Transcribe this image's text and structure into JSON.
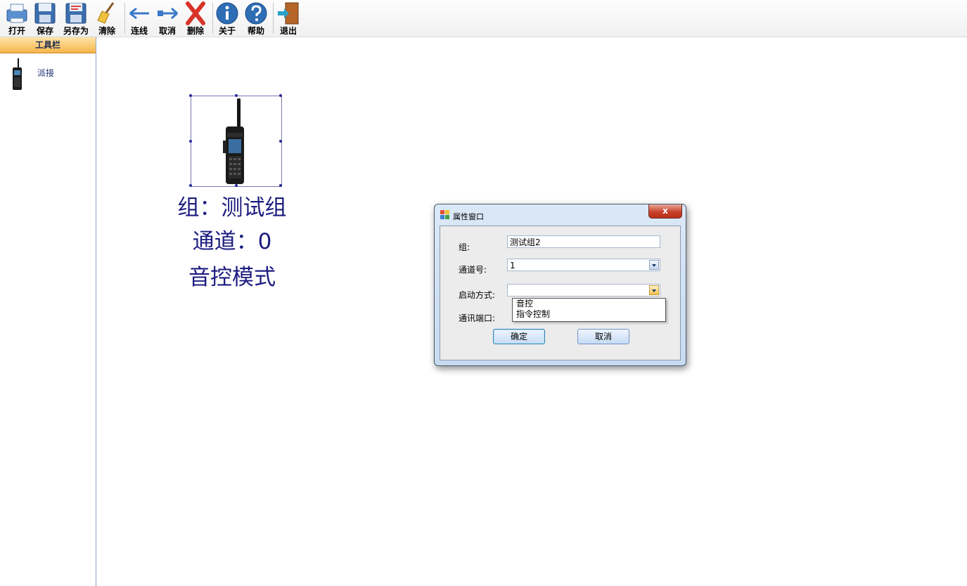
{
  "toolbar": {
    "buttons": [
      {
        "label": "打开",
        "icon": "open-printer-icon"
      },
      {
        "label": "保存",
        "icon": "save-disk-icon"
      },
      {
        "label": "另存为",
        "icon": "save-as-disk-icon"
      },
      {
        "label": "清除",
        "icon": "broom-icon"
      },
      {
        "label": "连线",
        "icon": "arrow-left-icon"
      },
      {
        "label": "取消",
        "icon": "arrow-right-icon"
      },
      {
        "label": "删除",
        "icon": "red-x-icon"
      },
      {
        "label": "关于",
        "icon": "info-icon"
      },
      {
        "label": "帮助",
        "icon": "help-icon"
      },
      {
        "label": "退出",
        "icon": "exit-door-icon"
      }
    ]
  },
  "sidebar": {
    "header": "工具栏",
    "items": [
      {
        "label": "派接",
        "icon": "walkie-talkie-icon"
      }
    ]
  },
  "canvas": {
    "node": {
      "icon": "walkie-talkie-icon",
      "group_text": "组：测试组",
      "channel_text": "通道：0",
      "mode_text": "音控模式"
    }
  },
  "dialog": {
    "title": "属性窗口",
    "close_label": "x",
    "group_label": "组:",
    "group_value": "测试组2",
    "channel_label": "通道号:",
    "channel_value": "1",
    "start_label": "启动方式:",
    "start_value": "",
    "start_options": [
      "音控",
      "指令控制"
    ],
    "port_label": "通讯端口:",
    "ok_label": "确定",
    "cancel_label": "取消"
  },
  "colors": {
    "node_text": "#1c1c80",
    "sidebar_header": "#f7b54a",
    "dialog_frame": "#c8dbf0"
  }
}
